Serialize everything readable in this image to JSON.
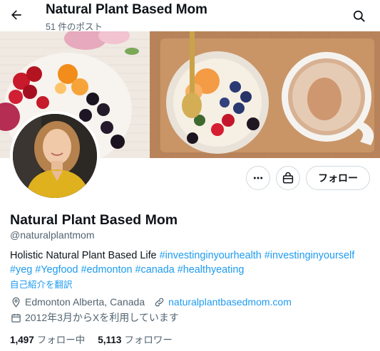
{
  "header": {
    "title": "Natural Plant Based Mom",
    "post_count": "51 件のポスト"
  },
  "profile": {
    "name": "Natural Plant Based Mom",
    "handle": "@naturalplantmom",
    "bio_text": "Holistic Natural Plant Based Life ",
    "bio_hashtags": [
      "#investinginyourhealth",
      "#investinginyourself",
      "#yeg",
      "#Yegfood",
      "#edmonton",
      "#canada",
      "#healthyeating"
    ],
    "translate_label": "自己紹介を翻訳",
    "location": "Edmonton Alberta, Canada",
    "website": "naturalplantbasedmom.com",
    "joined": "2012年3月からXを利用しています",
    "following_count": "1,497",
    "following_label": "フォロー中",
    "followers_count": "5,113",
    "followers_label": "フォロワー"
  },
  "actions": {
    "follow_label": "フォロー"
  },
  "icons": {
    "back": "arrow-left-icon",
    "search": "search-icon",
    "more": "more-icon",
    "shop": "shopping-bag-icon",
    "location": "location-pin-icon",
    "link": "link-icon",
    "calendar": "calendar-icon"
  },
  "colors": {
    "accent": "#1d9bf0",
    "text": "#0f1419",
    "muted": "#536471",
    "border": "#cfd9de"
  }
}
